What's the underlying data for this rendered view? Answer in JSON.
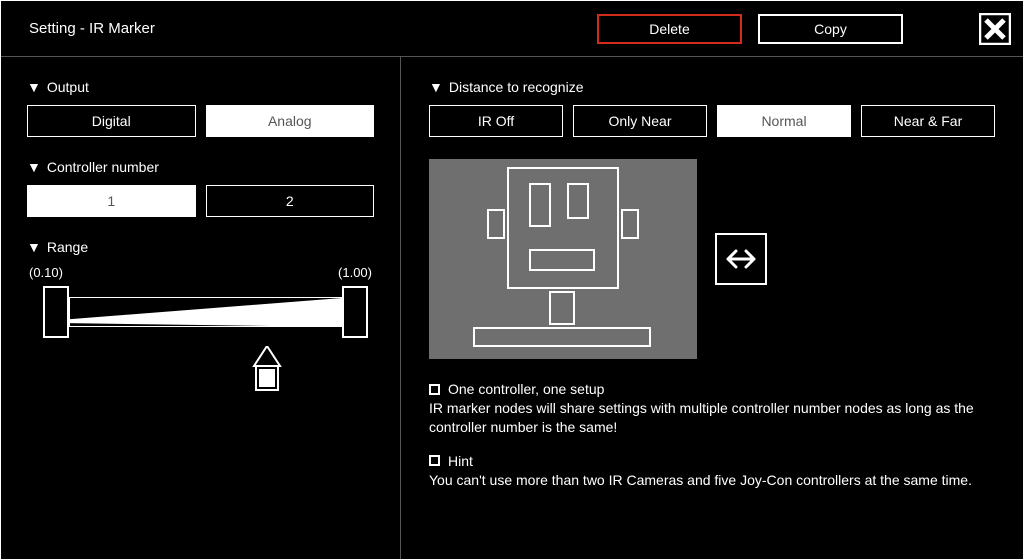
{
  "title": "Setting - IR Marker",
  "actions": {
    "delete": "Delete",
    "copy": "Copy"
  },
  "left": {
    "output": {
      "label": "Output",
      "options": [
        "Digital",
        "Analog"
      ],
      "selected": 1
    },
    "controller": {
      "label": "Controller number",
      "options": [
        "1",
        "2"
      ],
      "selected": 0
    },
    "range": {
      "label": "Range",
      "min_label": "(0.10)",
      "max_label": "(1.00)"
    }
  },
  "right": {
    "distance": {
      "label": "Distance to recognize",
      "options": [
        "IR Off",
        "Only Near",
        "Normal",
        "Near & Far"
      ],
      "selected": 2
    },
    "note1": {
      "heading": "One controller, one setup",
      "body": "IR marker nodes will share settings with multiple controller number nodes as long as the controller number is the same!"
    },
    "note2": {
      "heading": "Hint",
      "body": "You can't use more than two IR Cameras and five Joy-Con controllers at the same time."
    }
  }
}
